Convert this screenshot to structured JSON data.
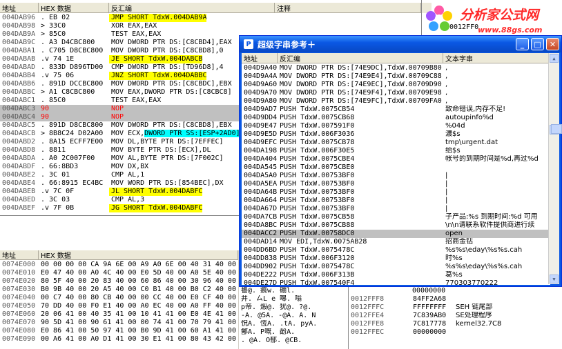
{
  "disasm": {
    "headers": {
      "addr": "地址",
      "hex": "HEX 数据",
      "dis": "反汇编",
      "comment": "注释"
    },
    "rows": [
      {
        "addr": "004DAB96",
        "hex": ".  EB 02",
        "dis": "JMP SHORT TdxW.004DAB9A",
        "style": "hl"
      },
      {
        "addr": "004DAB98",
        "hex": ">  33C0",
        "dis": "XOR EAX,EAX"
      },
      {
        "addr": "004DAB9A",
        "hex": ">  85C0",
        "dis": "TEST EAX,EAX"
      },
      {
        "addr": "004DAB9C",
        "hex": ".  A3 D4CBC800",
        "dis": "MOV DWORD PTR DS:[C8CBD4],EAX"
      },
      {
        "addr": "004DABA1",
        "hex": ".  C705 D8CBC800",
        "dis": "MOV DWORD PTR DS:[C8CBD8],0"
      },
      {
        "addr": "004DABAB",
        "hex": ".v 74 1E",
        "dis": "JE SHORT TdxW.004DABCB",
        "style": "hl"
      },
      {
        "addr": "004DABAD",
        "hex": ".  833D D896TD00",
        "dis": "CMP DWORD PTR DS:[TD96D8],4"
      },
      {
        "addr": "004DABB4",
        "hex": ".v 75 06",
        "dis": "JNZ SHORT TdxW.004DABBC",
        "style": "hl"
      },
      {
        "addr": "004DABB6",
        "hex": ".  891D DCCBC800",
        "dis": "MOV DWORD PTR DS:[C8CBDC],EBX"
      },
      {
        "addr": "004DABBC",
        "hex": ">  A1 C8CBC800",
        "dis": "MOV EAX,DWORD PTR DS:[C8CBC8]"
      },
      {
        "addr": "004DABC1",
        "hex": ".  85C0",
        "dis": "TEST EAX,EAX"
      },
      {
        "addr": "004DABC3",
        "hex": "   90",
        "dis": "NOP",
        "style": "red-sel"
      },
      {
        "addr": "004DABC4",
        "hex": "   90",
        "dis": "NOP",
        "style": "red-sel"
      },
      {
        "addr": "004DABC5",
        "hex": ".  891D D8CBC800",
        "dis": "MOV DWORD PTR DS:[C8CBD8],EBX"
      },
      {
        "addr": "004DABCB",
        "hex": ">  8B8C24 D02A00",
        "dis": "MOV ECX,DWORD PTR SS:[ESP+2AD0]",
        "style": "cyan"
      },
      {
        "addr": "004DABD2",
        "hex": ".  8A15 ECFF7E00",
        "dis": "MOV DL,BYTE PTR DS:[7EFFEC]"
      },
      {
        "addr": "004DABD8",
        "hex": ".  8811",
        "dis": "MOV BYTE PTR DS:[ECX],DL"
      },
      {
        "addr": "004DABDA",
        "hex": ".  A0 2C007F00",
        "dis": "MOV AL,BYTE PTR DS:[7F002C]"
      },
      {
        "addr": "004DABDF",
        "hex": ".  66:8BD3",
        "dis": "MOV DX,BX"
      },
      {
        "addr": "004DABE2",
        "hex": ".  3C 01",
        "dis": "CMP AL,1"
      },
      {
        "addr": "004DABE4",
        "hex": ".  66:8915 EC4BC",
        "dis": "MOV WORD PTR DS:[854BEC],DX"
      },
      {
        "addr": "004DABEB",
        "hex": ".v 7C 0F",
        "dis": "JL SHORT TdxW.004DABFC",
        "style": "hl"
      },
      {
        "addr": "004DABED",
        "hex": ".  3C 03",
        "dis": "CMP AL,3"
      },
      {
        "addr": "004DABEF",
        "hex": ".v 7F 0B",
        "dis": "JG SHORT TdxW.004DABFC",
        "style": "hl"
      }
    ]
  },
  "dump": {
    "headers": {
      "addr": "地址",
      "hex": "HEX 数据"
    },
    "rows": [
      {
        "addr": "0074E000",
        "hex": "00 00 00 00 CA 9A 6E 00 A9 A0 6E 00 40 31 40 00"
      },
      {
        "addr": "0074E010",
        "hex": "E0 47 40 00 A0 4C 40 00 E0 5D 40 00 A0 5E 40 00"
      },
      {
        "addr": "0074E020",
        "hex": "80 5F 40 00 20 83 40 00 60 86 40 00 30 96 40 00"
      },
      {
        "addr": "0074E030",
        "hex": "B0 9B 40 00 20 A5 40 00 C0 B1 40 00 B0 C2 40 00"
      },
      {
        "addr": "0074E040",
        "hex": "00 C7 40 00 80 CB 40 00 00 CC 40 00 E0 CF 40 00"
      },
      {
        "addr": "0074E050",
        "hex": "70 DD 40 00 F0 E1 40 00 A0 EC 40 00 A0 FF 40 00"
      },
      {
        "addr": "0074E060",
        "hex": "20 06 41 00 40 35 41 00 10 41 41 00 E0 4E 41 00"
      },
      {
        "addr": "0074E070",
        "hex": "90 5D 41 00 90 61 41 00 00 74 41 00 70 79 41 00"
      },
      {
        "addr": "0074E080",
        "hex": "E0 86 41 00 50 97 41 00 B0 9D 41 00 60 A1 41 00"
      },
      {
        "addr": "0074E090",
        "hex": "00 A6 41 00 A0 D1 41 00 30 E1 41 00 80 43 42 00"
      }
    ],
    "ascii": [
      "饔@.  痕w.  硼l.",
      "并.  ㄙL  e  嗥.  嗡",
      "p帝.  煅@.  犹@.  ?@.",
      "-A.  @5A.  -@A.  A.  N",
      "怳A.  恆A.  .tA.  pyA.",
      "鄶A.  P嘅.  酚A.",
      "  .  @A.  O郁.  @CB."
    ]
  },
  "stack": {
    "rows": [
      {
        "addr": "0012FFF8",
        "val": "84FF2A68",
        "comment": ""
      },
      {
        "addr": "0012FFFC",
        "val": "FFFFFFFF",
        "comment": "SEH 链尾部"
      },
      {
        "addr": "0012FFE4",
        "val": "7C839AB0",
        "comment": "SE处理程序"
      },
      {
        "addr": "0012FFE8",
        "val": "7C817778",
        "comment": "kernel32.7C8"
      },
      {
        "addr": "0012FFEC",
        "val": "00000000",
        "comment": ""
      }
    ],
    "top_val": "00000000",
    "top_right": "0012FF0"
  },
  "dialog": {
    "title": "超级字串参考＋",
    "icon_letter": "P",
    "headers": {
      "addr": "地址",
      "dis": "反汇编",
      "txt": "文本字串"
    },
    "rows": [
      {
        "addr": "004D9A40",
        "dis": "MOV DWORD PTR DS:[74E9DC],TdxW.00709B80",
        "txt": ","
      },
      {
        "addr": "004D9A4A",
        "dis": "MOV DWORD PTR DS:[74E9E4],TdxW.00709C88",
        "txt": ","
      },
      {
        "addr": "004D9A60",
        "dis": "MOV DWORD PTR DS:[74E9EC],TdxW.00709D90",
        "txt": ","
      },
      {
        "addr": "004D9A70",
        "dis": "MOV DWORD PTR DS:[74E9F4],TdxW.00709E98",
        "txt": ","
      },
      {
        "addr": "004D9A80",
        "dis": "MOV DWORD PTR DS:[74E9FC],TdxW.00709FA0",
        "txt": ","
      },
      {
        "addr": "004D9AD7",
        "dis": "PUSH TdxW.0075CB54",
        "txt": "致命错误,内存不足!"
      },
      {
        "addr": "004D9DD4",
        "dis": "PUSH TdxW.0075CB68",
        "txt": "autoupinfo%d"
      },
      {
        "addr": "004D9E47",
        "dis": "PUSH TdxW.007591F0",
        "txt": "%04d"
      },
      {
        "addr": "004D9E5D",
        "dis": "PUSH TdxW.006F3036",
        "txt": "濃$s"
      },
      {
        "addr": "004D9EFC",
        "dis": "PUSH TdxW.0075CB78",
        "txt": "tmp\\urgent.dat"
      },
      {
        "addr": "004DA198",
        "dis": "PUSH TdxW.006F30E5",
        "txt": "绐$s"
      },
      {
        "addr": "004DA404",
        "dis": "PUSH TdxW.0075CBE4",
        "txt": "帐号的到期时间是%d,再过%d"
      },
      {
        "addr": "004DA545",
        "dis": "PUSH TdxW.0075CBE0",
        "txt": ""
      },
      {
        "addr": "004DA5A0",
        "dis": "PUSH TdxW.00753BF0",
        "txt": "|"
      },
      {
        "addr": "004DA5EA",
        "dis": "PUSH TdxW.00753BF0",
        "txt": "|"
      },
      {
        "addr": "004DA64B",
        "dis": "PUSH TdxW.00753BF0",
        "txt": "|"
      },
      {
        "addr": "004DA664",
        "dis": "PUSH TdxW.00753BF0",
        "txt": "|"
      },
      {
        "addr": "004DA67D",
        "dis": "PUSH TdxW.00753BF0",
        "txt": "|"
      },
      {
        "addr": "004DA7CB",
        "dis": "PUSH TdxW.0075CB58",
        "txt": "子产品:%s 到期时间:%d 可用"
      },
      {
        "addr": "004DA8BC",
        "dis": "PUSH TdxW.0075CB88",
        "txt": "\\n\\n请联系软件提供商进行续"
      },
      {
        "addr": "004DACC2",
        "dis": "PUSH TdxW.00758DC0",
        "txt": "open",
        "sel": true
      },
      {
        "addr": "004DAD14",
        "dis": "MOV EDI,TdxW.0075AB28",
        "txt": "招商金钻"
      },
      {
        "addr": "004DD6BD",
        "dis": "PUSH TdxW.0075478C",
        "txt": "%s%s\\eday\\%s%s.cah"
      },
      {
        "addr": "004DD838",
        "dis": "PUSH TdxW.006F3120",
        "txt": "时%s"
      },
      {
        "addr": "004DD902",
        "dis": "PUSH TdxW.0075478C",
        "txt": "%s%s\\eday\\%s%s.cah"
      },
      {
        "addr": "004DE222",
        "dis": "PUSH TdxW.006F313B",
        "txt": "葛%s"
      },
      {
        "addr": "004DE27D",
        "dis": "PUSH TdxW.007540F4",
        "txt": "770303770222"
      }
    ]
  },
  "logo": {
    "text": "分析家公式网",
    "url": "www.88gs.com"
  },
  "colors": {
    "highlight": "#ffff00",
    "nop": "#ff0000",
    "cyan": "#00ffff",
    "title": "#0a58e4"
  }
}
